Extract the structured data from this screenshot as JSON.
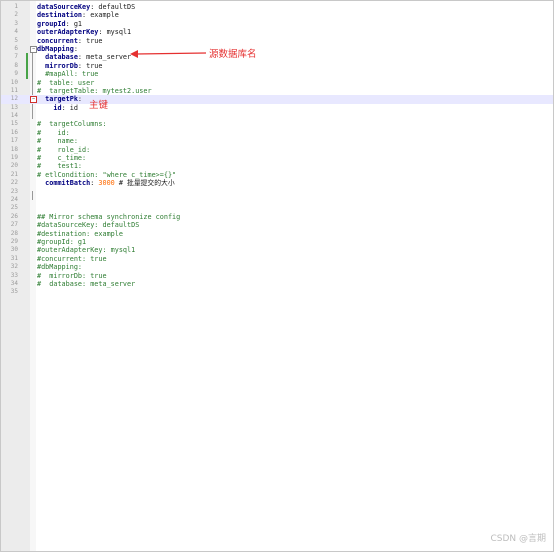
{
  "editor": {
    "lines": [
      {
        "num": "1",
        "parts": [
          {
            "t": "dataSourceKey",
            "c": "k"
          },
          {
            "t": ": defaultDS",
            "c": "v"
          }
        ]
      },
      {
        "num": "2",
        "parts": [
          {
            "t": "destination",
            "c": "k"
          },
          {
            "t": ": example",
            "c": "v"
          }
        ]
      },
      {
        "num": "3",
        "parts": [
          {
            "t": "groupId",
            "c": "k"
          },
          {
            "t": ": g1",
            "c": "v"
          }
        ]
      },
      {
        "num": "4",
        "parts": [
          {
            "t": "outerAdapterKey",
            "c": "k"
          },
          {
            "t": ": mysql1",
            "c": "v"
          }
        ]
      },
      {
        "num": "5",
        "parts": [
          {
            "t": "concurrent",
            "c": "k"
          },
          {
            "t": ": true",
            "c": "v"
          }
        ]
      },
      {
        "num": "6",
        "parts": [
          {
            "t": "dbMapping",
            "c": "k"
          },
          {
            "t": ":",
            "c": "v"
          }
        ]
      },
      {
        "num": "7",
        "parts": [
          {
            "t": "  database",
            "c": "k"
          },
          {
            "t": ": meta_server",
            "c": "v"
          }
        ]
      },
      {
        "num": "8",
        "parts": [
          {
            "t": "  mirrorDb",
            "c": "k"
          },
          {
            "t": ": true",
            "c": "v"
          }
        ]
      },
      {
        "num": "9",
        "parts": [
          {
            "t": "  #mapAll: true",
            "c": "c"
          }
        ]
      },
      {
        "num": "10",
        "parts": [
          {
            "t": "#  table: user",
            "c": "c"
          }
        ]
      },
      {
        "num": "11",
        "parts": [
          {
            "t": "#  targetTable: mytest2.user",
            "c": "c"
          }
        ]
      },
      {
        "num": "12",
        "parts": [
          {
            "t": "  targetPk",
            "c": "k"
          },
          {
            "t": ":",
            "c": "v"
          }
        ]
      },
      {
        "num": "13",
        "parts": [
          {
            "t": "    id",
            "c": "k"
          },
          {
            "t": ": id",
            "c": "v"
          }
        ]
      },
      {
        "num": "14",
        "parts": []
      },
      {
        "num": "15",
        "parts": [
          {
            "t": "#  targetColumns:",
            "c": "c"
          }
        ]
      },
      {
        "num": "16",
        "parts": [
          {
            "t": "#    id:",
            "c": "c"
          }
        ]
      },
      {
        "num": "17",
        "parts": [
          {
            "t": "#    name:",
            "c": "c"
          }
        ]
      },
      {
        "num": "18",
        "parts": [
          {
            "t": "#    role_id:",
            "c": "c"
          }
        ]
      },
      {
        "num": "19",
        "parts": [
          {
            "t": "#    c_time:",
            "c": "c"
          }
        ]
      },
      {
        "num": "20",
        "parts": [
          {
            "t": "#    test1:",
            "c": "c"
          }
        ]
      },
      {
        "num": "21",
        "parts": [
          {
            "t": "# etlCondition: \"where c_time>={}\"",
            "c": "c"
          }
        ]
      },
      {
        "num": "22",
        "parts": [
          {
            "t": "  commitBatch",
            "c": "k"
          },
          {
            "t": ": ",
            "c": "v"
          },
          {
            "t": "3000",
            "c": "n"
          },
          {
            "t": " # 批量提交的大小",
            "c": "v"
          }
        ]
      },
      {
        "num": "23",
        "parts": []
      },
      {
        "num": "24",
        "parts": []
      },
      {
        "num": "25",
        "parts": []
      },
      {
        "num": "26",
        "parts": [
          {
            "t": "## Mirror schema synchronize config",
            "c": "c"
          }
        ]
      },
      {
        "num": "27",
        "parts": [
          {
            "t": "#dataSourceKey: defaultDS",
            "c": "c"
          }
        ]
      },
      {
        "num": "28",
        "parts": [
          {
            "t": "#destination: example",
            "c": "c"
          }
        ]
      },
      {
        "num": "29",
        "parts": [
          {
            "t": "#groupId: g1",
            "c": "c"
          }
        ]
      },
      {
        "num": "30",
        "parts": [
          {
            "t": "#outerAdapterKey: mysql1",
            "c": "c"
          }
        ]
      },
      {
        "num": "31",
        "parts": [
          {
            "t": "#concurrent: true",
            "c": "c"
          }
        ]
      },
      {
        "num": "32",
        "parts": [
          {
            "t": "#dbMapping:",
            "c": "c"
          }
        ]
      },
      {
        "num": "33",
        "parts": [
          {
            "t": "#  mirrorDb: true",
            "c": "c"
          }
        ]
      },
      {
        "num": "34",
        "parts": [
          {
            "t": "#  database: meta_server",
            "c": "c"
          }
        ]
      },
      {
        "num": "35",
        "parts": []
      }
    ]
  },
  "annotations": {
    "database_note": "源数据库名",
    "pk_note": "主键"
  },
  "watermark": "CSDN @言期",
  "colors": {
    "key": "#000080",
    "comment": "#2e7d32",
    "number": "#ff6a00",
    "annotation": "#e53030",
    "highlight": "#e8e8ff"
  }
}
